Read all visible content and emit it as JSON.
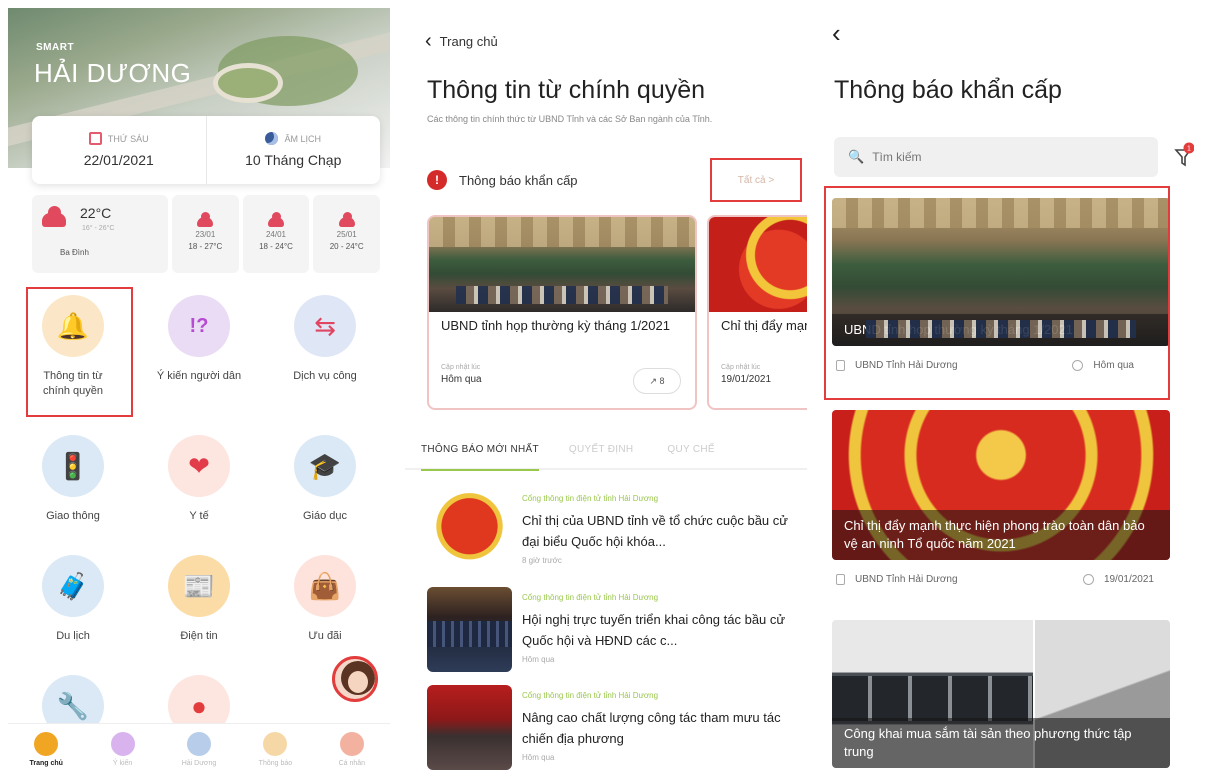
{
  "panel1": {
    "brand_small": "SMART",
    "brand_big": "HẢI DƯƠNG",
    "date": {
      "day_label": "THỨ SÁU",
      "day_value": "22/01/2021",
      "lunar_label": "ÂM LỊCH",
      "lunar_value": "10 Tháng Chạp"
    },
    "weather": {
      "now_temp": "22°C",
      "now_range": "16° - 26°C",
      "location": "Ba Đình",
      "days": [
        {
          "date": "23/01",
          "range": "18 - 27°C"
        },
        {
          "date": "24/01",
          "range": "18 - 24°C"
        },
        {
          "date": "25/01",
          "range": "20 - 24°C"
        }
      ]
    },
    "tiles": [
      {
        "label": "Thông tin từ chính quyền",
        "icon": "bell-icon"
      },
      {
        "label": "Ý kiến người dân",
        "icon": "feedback-icon"
      },
      {
        "label": "Dịch vụ công",
        "icon": "public-service-icon"
      },
      {
        "label": "Giao thông",
        "icon": "traffic-light-icon"
      },
      {
        "label": "Y tế",
        "icon": "heart-icon"
      },
      {
        "label": "Giáo dục",
        "icon": "education-icon"
      },
      {
        "label": "Du lịch",
        "icon": "luggage-icon"
      },
      {
        "label": "Điện tin",
        "icon": "newspaper-icon"
      },
      {
        "label": "Ưu đãi",
        "icon": "shopping-bag-icon"
      }
    ],
    "tabbar": [
      {
        "label": "Trang chủ",
        "active": true
      },
      {
        "label": "Ý kiến",
        "active": false
      },
      {
        "label": "Hải Dương",
        "active": false
      },
      {
        "label": "Thông báo",
        "active": false
      },
      {
        "label": "Cá nhân",
        "active": false
      }
    ]
  },
  "panel2": {
    "back_label": "Trang chủ",
    "title": "Thông tin từ chính quyền",
    "description": "Các thông tin chính thức từ UBND Tỉnh và các Sở Ban ngành của Tỉnh.",
    "emergency_label": "Thông báo khẩn cấp",
    "see_more": "Tất cả >",
    "emergency_cards": [
      {
        "title": "UBND tỉnh họp thường kỳ tháng 1/2021",
        "updated_label": "Cập nhật lúc",
        "updated_value": "Hôm qua",
        "share": "8"
      },
      {
        "title": "Chỉ thị đẩy mạnh phong trào t",
        "updated_label": "Cập nhật lúc",
        "updated_value": "19/01/2021"
      }
    ],
    "news_tabs": [
      "THÔNG BÁO MỚI NHẤT",
      "QUYẾT ĐỊNH",
      "QUY CHẾ"
    ],
    "news": [
      {
        "source": "Cổng thông tin điện tử tỉnh Hải Dương",
        "title": "Chỉ thị của UBND tỉnh về tổ chức cuộc bầu cử đại biểu Quốc hội khóa...",
        "time": "8 giờ trước"
      },
      {
        "source": "Cổng thông tin điện tử tỉnh Hải Dương",
        "title": "Hội nghị trực tuyến triển khai công tác bầu cử Quốc hội và HĐND các c...",
        "time": "Hôm qua"
      },
      {
        "source": "Cổng thông tin điện tử tỉnh Hải Dương",
        "title": "Nâng cao chất lượng công tác tham mưu tác chiến địa phương",
        "time": "Hôm qua"
      }
    ]
  },
  "panel3": {
    "title": "Thông báo khẩn cấp",
    "search_placeholder": "Tìm kiếm",
    "filter_badge": "1",
    "cards": [
      {
        "caption": "UBND tỉnh họp thường kỳ tháng 1/2021",
        "source": "UBND Tỉnh Hải Dương",
        "date": "Hôm qua"
      },
      {
        "caption": "Chỉ thị đẩy mạnh thực hiện phong trào toàn dân bảo vệ an ninh Tổ quốc năm 2021",
        "source": "UBND Tỉnh Hải Dương",
        "date": "19/01/2021"
      },
      {
        "caption": "Công khai mua sắm tài sản theo phương thức tập trung"
      }
    ]
  },
  "colors": {
    "highlight": "#e23c3c",
    "alert": "#d42a2a",
    "accent_green": "#9ac84c"
  }
}
